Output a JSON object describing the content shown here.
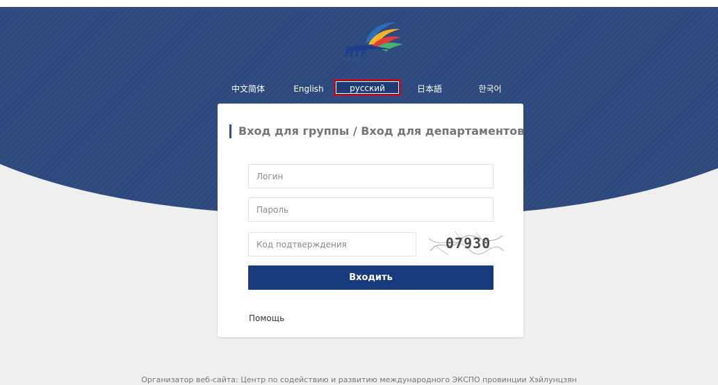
{
  "brand": {
    "logo_text": "HTF",
    "colors": {
      "hero_blue": "#2e4a7d",
      "button_blue": "#183b7c",
      "active_outline": "#d9001b",
      "title_accent": "#2a4f9e"
    }
  },
  "languages": [
    {
      "label": "中文简体",
      "active": false
    },
    {
      "label": "English",
      "active": false
    },
    {
      "label": "русский",
      "active": true
    },
    {
      "label": "日本語",
      "active": false
    },
    {
      "label": "한국어",
      "active": false
    }
  ],
  "login": {
    "title": "Вход для группы / Вход для департаментов",
    "login_placeholder": "Логин",
    "password_placeholder": "Пароль",
    "captcha_placeholder": "Код подтверждения",
    "captcha_code": "07930",
    "submit_label": "Входить",
    "help_label": "Помощь"
  },
  "footer": {
    "text": "Организатор веб-сайта: Центр по содействию и развитию международного ЭКСПО провинции Хэйлунцзян"
  }
}
